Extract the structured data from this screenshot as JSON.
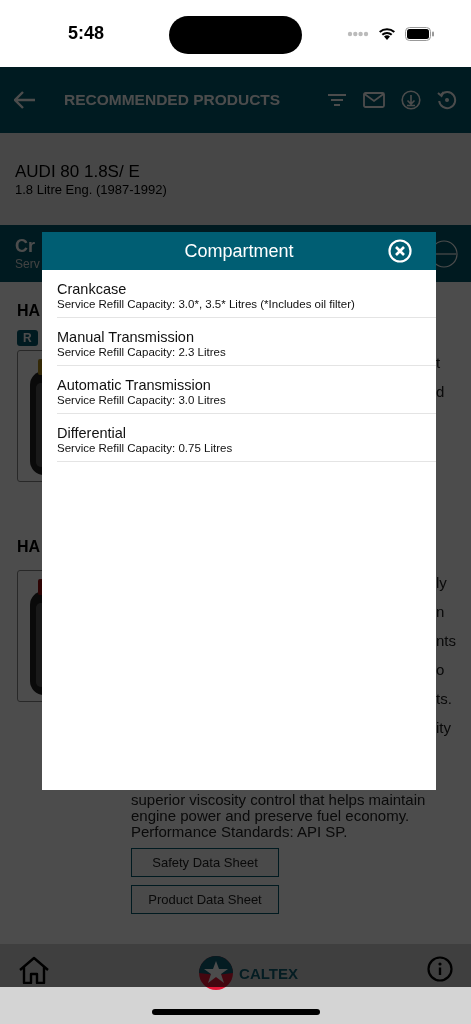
{
  "status_bar": {
    "time": "5:48"
  },
  "header": {
    "title": "RECOMMENDED PRODUCTS"
  },
  "vehicle": {
    "name": "AUDI 80 1.8S/ E",
    "engine": "1.8 Litre Eng. (1987-1992)"
  },
  "compartment_bar": {
    "title": "Cr",
    "subtitle": "Serv",
    "expanded": true
  },
  "products": [
    {
      "heading": "HA",
      "badge": "R",
      "fragments": [
        "t",
        "d"
      ]
    },
    {
      "heading": "HA",
      "fragments": [
        "ly",
        "n",
        "nts",
        "o",
        "ts.",
        "ity"
      ],
      "description": "superior viscosity control that helps maintain engine power and preserve fuel economy. Performance Standards: API SP.",
      "buttons": [
        "Safety Data Sheet",
        "Product Data Sheet"
      ]
    }
  ],
  "modal": {
    "title": "Compartment",
    "items": [
      {
        "name": "Crankcase",
        "capacity": "Service Refill Capacity: 3.0*, 3.5* Litres (*Includes oil filter)"
      },
      {
        "name": "Manual Transmission",
        "capacity": "Service Refill Capacity: 2.3 Litres"
      },
      {
        "name": "Automatic Transmission",
        "capacity": "Service Refill Capacity: 3.0 Litres"
      },
      {
        "name": "Differential",
        "capacity": "Service Refill Capacity: 0.75 Litres"
      }
    ]
  },
  "bottom_bar": {
    "logo_text": "CALTEX"
  }
}
